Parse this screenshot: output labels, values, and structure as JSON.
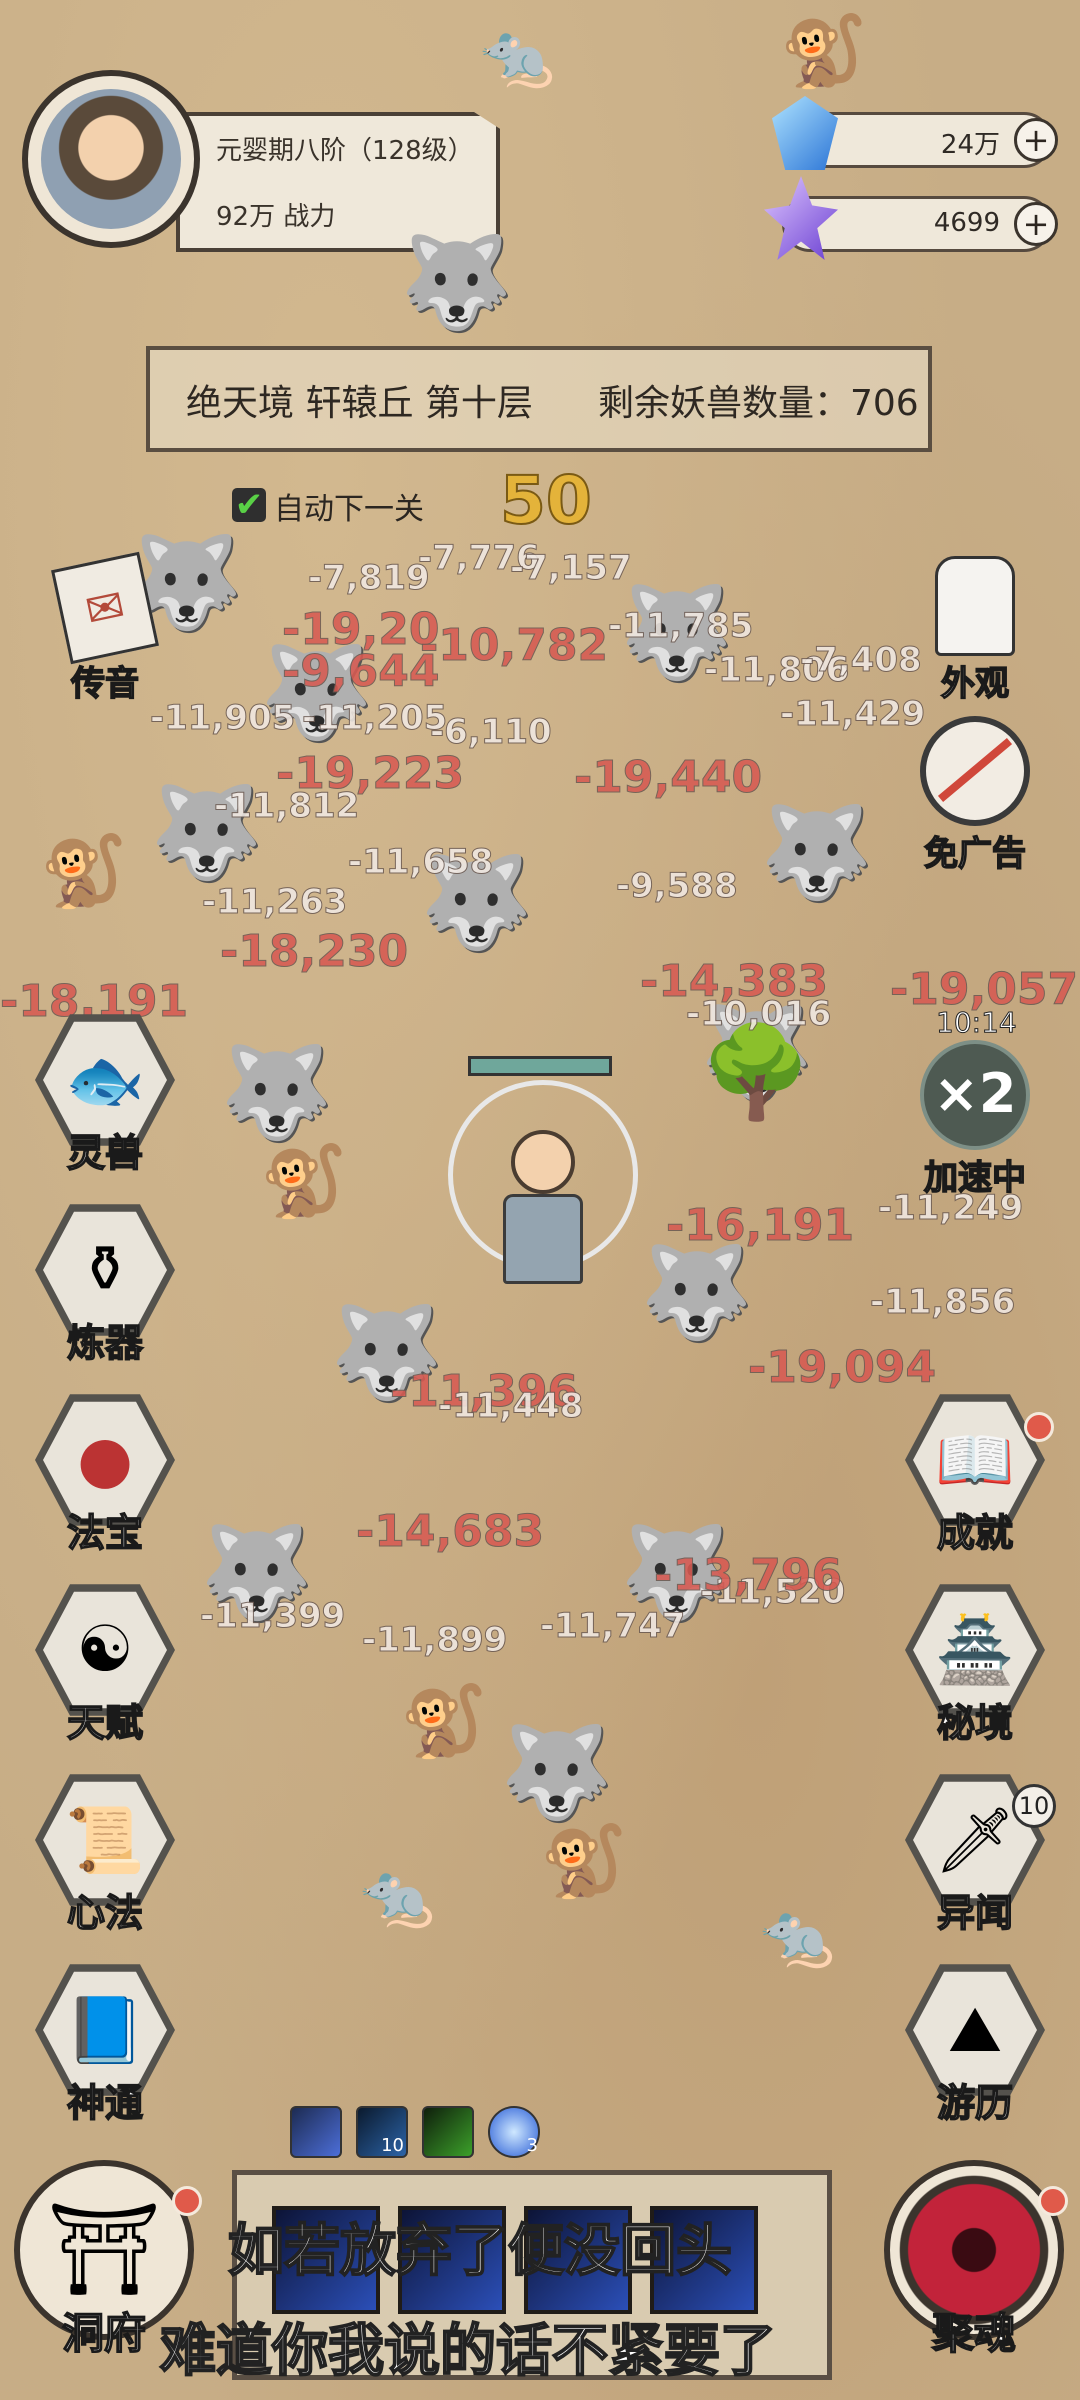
{
  "player": {
    "realm": "元婴期八阶（128级）",
    "power": "92万 战力"
  },
  "resources": [
    {
      "name": "blue-crystal",
      "value": "24万"
    },
    {
      "name": "purple-crystal",
      "value": "4699"
    }
  ],
  "stage": {
    "location": "绝天境 轩辕丘 第十层",
    "remaining": "剩余妖兽数量：706"
  },
  "auto_next": {
    "label": "自动下一关",
    "checked": true
  },
  "wave_counter": "50",
  "left_menu": [
    {
      "label": "传音",
      "icon": "letter-icon"
    },
    {
      "label": "灵兽",
      "icon": "spirit-fish-icon"
    },
    {
      "label": "炼器",
      "icon": "cauldron-icon"
    },
    {
      "label": "法宝",
      "icon": "gourd-icon"
    },
    {
      "label": "天赋",
      "icon": "yin-yang-icon"
    },
    {
      "label": "心法",
      "icon": "scroll-icon"
    },
    {
      "label": "神通",
      "icon": "sword-book-icon"
    },
    {
      "label": "洞府",
      "icon": "pavilion-icon"
    }
  ],
  "right_menu": [
    {
      "label": "外观",
      "icon": "robe-icon"
    },
    {
      "label": "免广告",
      "icon": "no-ads-icon"
    },
    {
      "label": "加速中",
      "icon": "speed-x2-icon",
      "multiplier": "×2",
      "timer": "10:14"
    },
    {
      "label": "成就",
      "icon": "achievement-book-icon"
    },
    {
      "label": "秘境",
      "icon": "secret-realm-icon"
    },
    {
      "label": "异闻",
      "icon": "rumor-sword-icon",
      "badge": "10"
    },
    {
      "label": "游历",
      "icon": "mountain-icon"
    },
    {
      "label": "聚魂",
      "icon": "soul-vortex-icon"
    }
  ],
  "skills": [
    {
      "icon": "blue-slash-icon",
      "count": ""
    },
    {
      "icon": "lightning-icon",
      "count": "10"
    },
    {
      "icon": "green-shadow-icon",
      "count": ""
    },
    {
      "icon": "blue-orb-icon",
      "count": "3"
    }
  ],
  "damage_numbers": [
    "-7,776",
    "-7,157",
    "-7,819",
    "-19,20",
    "-10,782",
    "-9,644",
    "-11,785",
    "-11,806",
    "-7,408",
    "-11,905",
    "-11,205",
    "-11,429",
    "-6,110",
    "-19,223",
    "-19,440",
    "-11,812",
    "-11,658",
    "-9,588",
    "-11,263",
    "-18,230",
    "-18,191",
    "-14,383",
    "-19,057",
    "-10,016",
    "-11,249",
    "-16,191",
    "-11,856",
    "-19,094",
    "-14,683",
    "-11,396",
    "-11,448",
    "-11,520",
    "-11,747",
    "-11,399",
    "-13,796",
    "-11,899"
  ],
  "subtitles": {
    "line1": "如若放弃了便没回头",
    "line2": "难道你我说的话不紧要了"
  }
}
